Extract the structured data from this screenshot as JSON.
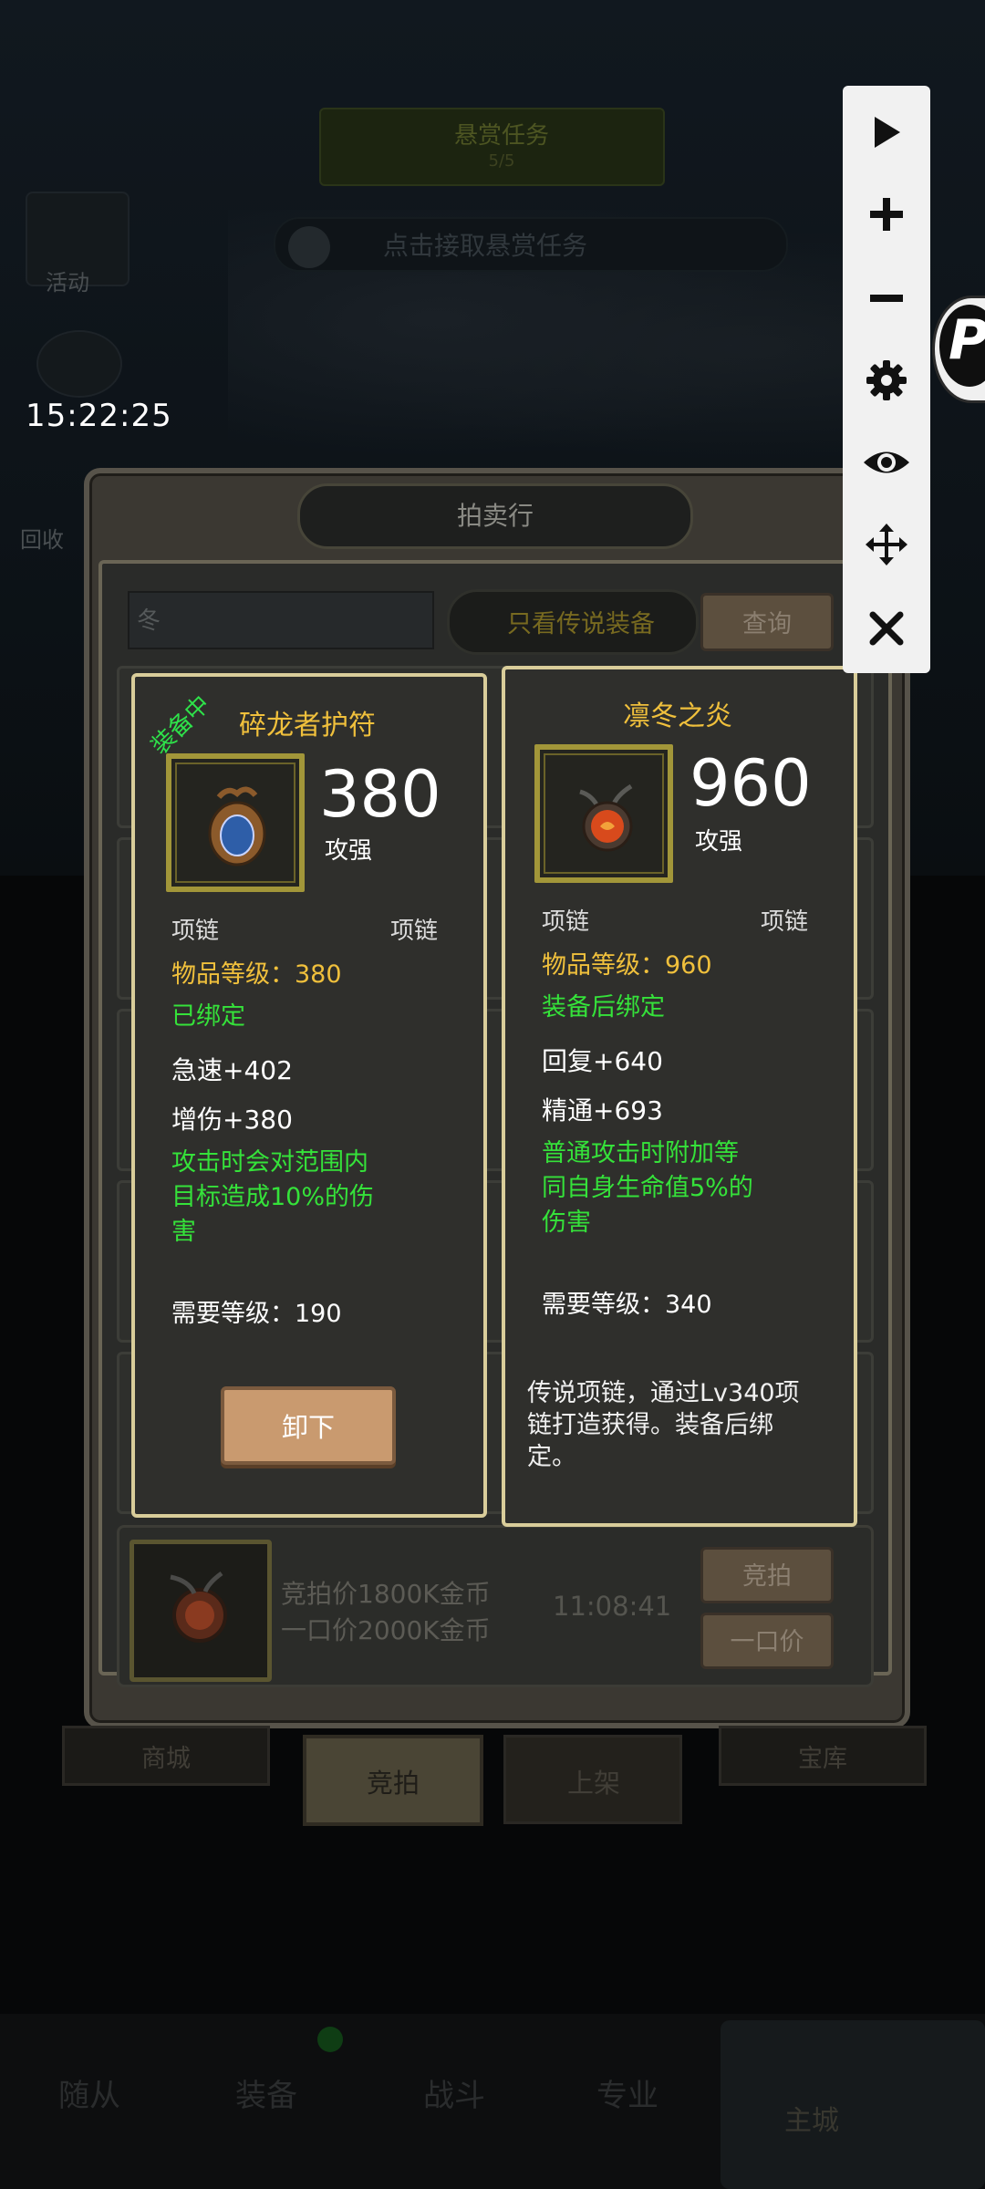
{
  "status": {
    "time": "15:22:25"
  },
  "background": {
    "bounty_title": "悬赏任务",
    "bounty_sub": "5/5",
    "bounty_task": "点击接取悬赏任务",
    "left_label_1": "活动",
    "left_label_2": "回收"
  },
  "auction": {
    "title": "拍卖行",
    "search_value": "冬",
    "legend_filter": "只看传说装备",
    "query_label": "查询",
    "listing": {
      "bid_price": "竞拍价1800K金币",
      "buyout_price": "一口价2000K金币",
      "time_left": "11:08:41",
      "bid_label": "竞拍",
      "buyout_label": "一口价"
    },
    "tabs": [
      {
        "label": "商城"
      },
      {
        "label": "竞拍"
      },
      {
        "label": "上架"
      },
      {
        "label": "宝库"
      }
    ]
  },
  "equipped_item": {
    "tag": "装备中",
    "name": "碎龙者护符",
    "value": "380",
    "stat": "攻强",
    "type_left": "项链",
    "type_right": "项链",
    "item_level": "物品等级：380",
    "bind": "已绑定",
    "attrs": [
      "急速+402",
      "增伤+380"
    ],
    "effect": [
      "攻击时会对范围内",
      "目标造成10%的伤",
      "害"
    ],
    "req_level": "需要等级：190",
    "unequip_label": "卸下"
  },
  "compare_item": {
    "name": "凛冬之炎",
    "value": "960",
    "stat": "攻强",
    "type_left": "项链",
    "type_right": "项链",
    "item_level": "物品等级：960",
    "bind": "装备后绑定",
    "attrs": [
      "回复+640",
      "精通+693"
    ],
    "effect": [
      "普通攻击时附加等",
      "同自身生命值5%的",
      "伤害"
    ],
    "req_level": "需要等级：340",
    "flavor": [
      "传说项链，通过Lv340项",
      "链打造获得。装备后绑",
      "定。"
    ]
  },
  "overlay_toolbar": {
    "icons": [
      "play-icon",
      "plus-icon",
      "minus-icon",
      "gear-icon",
      "eye-icon",
      "move-icon",
      "close-icon"
    ],
    "float_ball_letter": "P"
  },
  "bottom_nav": {
    "items": [
      "随从",
      "装备",
      "战斗",
      "专业"
    ],
    "home": "主城"
  }
}
